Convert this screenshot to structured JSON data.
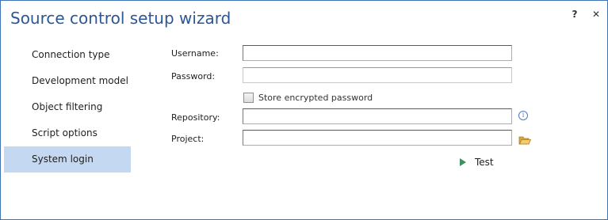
{
  "window": {
    "title": "Source control setup wizard",
    "help_label": "?",
    "close_label": "✕"
  },
  "nav": {
    "items": [
      {
        "label": "Connection type"
      },
      {
        "label": "Development model"
      },
      {
        "label": "Object filtering"
      },
      {
        "label": "Script options"
      },
      {
        "label": "System login",
        "active": true
      }
    ]
  },
  "form": {
    "username": {
      "label": "Username:",
      "value": ""
    },
    "password": {
      "label": "Password:",
      "value": ""
    },
    "store_encrypted": {
      "label": "Store encrypted password",
      "checked": false
    },
    "repository": {
      "label": "Repository:",
      "value": ""
    },
    "project": {
      "label": "Project:",
      "value": ""
    }
  },
  "actions": {
    "test_label": "Test"
  },
  "icons": {
    "info": "info-icon",
    "folder": "folder-open-icon",
    "play": "play-icon"
  },
  "colors": {
    "title": "#2b5797",
    "active_nav": "#c5d8f2",
    "test_play": "#3f8f5f",
    "folder": "#e8b84a"
  }
}
